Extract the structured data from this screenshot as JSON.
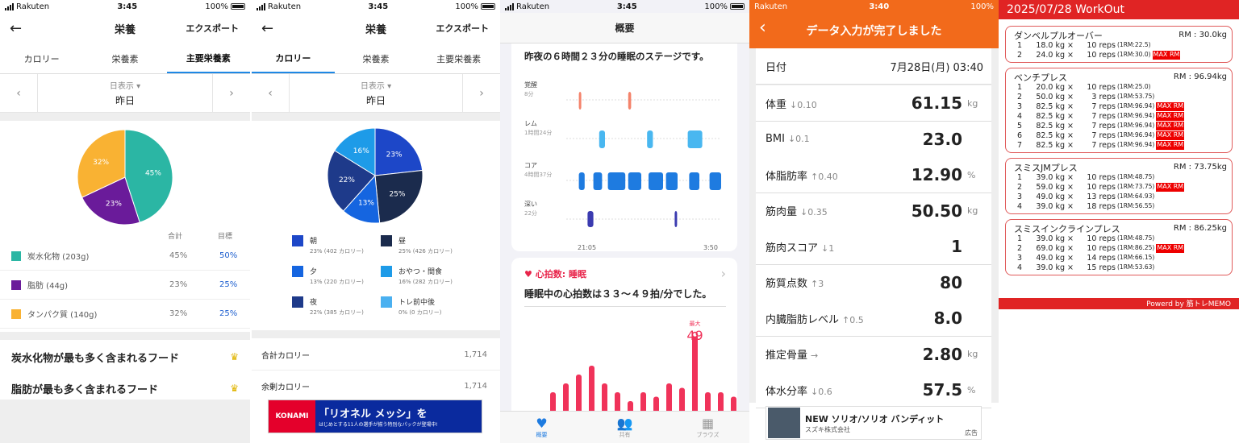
{
  "status": {
    "carrier": "Rakuten",
    "battery": "100%",
    "time1": "3:45",
    "time2": "3:45",
    "time3": "3:45",
    "time4": "3:40"
  },
  "p1": {
    "title": "栄養",
    "export": "エクスポート",
    "tabs": [
      "カロリー",
      "栄養素",
      "主要栄養素"
    ],
    "day_mode": "日表示",
    "day": "昨日",
    "pie": [
      {
        "pct": 45,
        "label": "45%",
        "color": "#2bb6a4"
      },
      {
        "pct": 23,
        "label": "23%",
        "color": "#6a1b9a"
      },
      {
        "pct": 32,
        "label": "32%",
        "color": "#f9b233"
      }
    ],
    "col_total": "合計",
    "col_goal": "目標",
    "rows": [
      {
        "name": "炭水化物 (203g)",
        "total": "45%",
        "goal": "50%",
        "color": "#2bb6a4"
      },
      {
        "name": "脂肪 (44g)",
        "total": "23%",
        "goal": "25%",
        "color": "#6a1b9a"
      },
      {
        "name": "タンパク質 (140g)",
        "total": "32%",
        "goal": "25%",
        "color": "#f9b233"
      }
    ],
    "food1": "炭水化物が最も多く含まれるフード",
    "food2": "脂肪が最も多く含まれるフード"
  },
  "p2": {
    "title": "栄養",
    "export": "エクスポート",
    "tabs": [
      "カロリー",
      "栄養素",
      "主要栄養素"
    ],
    "day_mode": "日表示",
    "day": "昨日",
    "pie": [
      {
        "pct": 23,
        "label": "23%",
        "color": "#1d47c8"
      },
      {
        "pct": 25,
        "label": "25%",
        "color": "#1b2b4d"
      },
      {
        "pct": 13,
        "label": "13%",
        "color": "#1565e0"
      },
      {
        "pct": 22,
        "label": "22%",
        "color": "#1e3a8a"
      },
      {
        "pct": 16,
        "label": "16%",
        "color": "#1e9be8"
      },
      {
        "pct": 0,
        "label": "",
        "color": "#4ab0f0"
      }
    ],
    "legend": [
      {
        "name": "朝",
        "sub": "23% (402 カロリー)",
        "color": "#1d47c8"
      },
      {
        "name": "昼",
        "sub": "25% (426 カロリー)",
        "color": "#1b2b4d"
      },
      {
        "name": "夕",
        "sub": "13% (220 カロリー)",
        "color": "#1565e0"
      },
      {
        "name": "おやつ・間食",
        "sub": "16% (282 カロリー)",
        "color": "#1e9be8"
      },
      {
        "name": "夜",
        "sub": "22% (385 カロリー)",
        "color": "#1e3a8a"
      },
      {
        "name": "トレ前中後",
        "sub": "0% (0 カロリー)",
        "color": "#4ab0f0"
      }
    ],
    "total_label": "合計カロリー",
    "total_val": "1,714",
    "remain_label": "余剰カロリー",
    "remain_val": "1,714",
    "ad_brand": "KONAMI",
    "ad_text": "「リオネル メッシ」を",
    "ad_sub": "はじめとする11人の選手が揃う特別なパックが登場中!"
  },
  "p3": {
    "title": "概要",
    "sleep_title": "昨夜の６時間２３分の睡眠のステージです。",
    "stages": [
      {
        "name": "覚醒",
        "dur": "8分",
        "color": "#f4836b"
      },
      {
        "name": "レム",
        "dur": "1時間24分",
        "color": "#49b7f0"
      },
      {
        "name": "コア",
        "dur": "4時間37分",
        "color": "#1e7be0"
      },
      {
        "name": "深い",
        "dur": "22分",
        "color": "#3b3bb0"
      }
    ],
    "t_start": "21:05",
    "t_end": "3:50",
    "hr_tag": "心拍数: 睡眠",
    "hr_text": "睡眠中の心拍数は３３〜４９拍/分でした。",
    "max_label": "最大",
    "max_val": "49",
    "hr_bars": [
      36,
      38,
      40,
      42,
      38,
      36,
      34,
      36,
      35,
      38,
      37,
      49,
      36,
      36,
      35
    ],
    "tabs": [
      "概要",
      "共有",
      "ブラウズ"
    ]
  },
  "p4": {
    "header": "データ入力が完了しました",
    "date_label": "日付",
    "date_val": "7月28日(月) 03:40",
    "rows": [
      {
        "label": "体重",
        "delta": "↓0.10",
        "val": "61.15",
        "unit": "kg"
      },
      {
        "label": "BMI",
        "delta": "↓0.1",
        "val": "23.0",
        "unit": ""
      },
      {
        "label": "体脂肪率",
        "delta": "↑0.40",
        "val": "12.90",
        "unit": "%"
      },
      {
        "label": "筋肉量",
        "delta": "↓0.35",
        "val": "50.50",
        "unit": "kg"
      },
      {
        "label": "筋肉スコア",
        "delta": "↓1",
        "val": "1",
        "unit": ""
      },
      {
        "label": "筋質点数",
        "delta": "↑3",
        "val": "80",
        "unit": ""
      },
      {
        "label": "内臓脂肪レベル",
        "delta": "↑0.5",
        "val": "8.0",
        "unit": ""
      },
      {
        "label": "推定骨量",
        "delta": "→",
        "val": "2.80",
        "unit": "kg"
      },
      {
        "label": "体水分率",
        "delta": "↓0.6",
        "val": "57.5",
        "unit": "%"
      }
    ],
    "ad_title": "NEW ソリオ/ソリオ バンディット",
    "ad_company": "スズキ株式会社",
    "ad_tag": "広告"
  },
  "p5": {
    "title": "2025/07/28 WorkOut",
    "footer": "Powerd by 筋トレMEMO",
    "maxrm": "MAX RM",
    "exercises": [
      {
        "name": "ダンベルプルオーバー",
        "rm": "RM : 30.0kg",
        "sets": [
          {
            "n": "1",
            "kg": "18.0 kg ×",
            "reps": "10 reps",
            "rm": "(1RM:22.5)",
            "max": false
          },
          {
            "n": "2",
            "kg": "24.0 kg ×",
            "reps": "10 reps",
            "rm": "(1RM:30.0)",
            "max": true
          }
        ]
      },
      {
        "name": "ベンチプレス",
        "rm": "RM : 96.94kg",
        "sets": [
          {
            "n": "1",
            "kg": "20.0 kg ×",
            "reps": "10 reps",
            "rm": "(1RM:25.0)",
            "max": false
          },
          {
            "n": "2",
            "kg": "50.0 kg ×",
            "reps": "3 reps",
            "rm": "(1RM:53.75)",
            "max": false
          },
          {
            "n": "3",
            "kg": "82.5 kg ×",
            "reps": "7 reps",
            "rm": "(1RM:96.94)",
            "max": true
          },
          {
            "n": "4",
            "kg": "82.5 kg ×",
            "reps": "7 reps",
            "rm": "(1RM:96.94)",
            "max": true
          },
          {
            "n": "5",
            "kg": "82.5 kg ×",
            "reps": "7 reps",
            "rm": "(1RM:96.94)",
            "max": true
          },
          {
            "n": "6",
            "kg": "82.5 kg ×",
            "reps": "7 reps",
            "rm": "(1RM:96.94)",
            "max": true
          },
          {
            "n": "7",
            "kg": "82.5 kg ×",
            "reps": "7 reps",
            "rm": "(1RM:96.94)",
            "max": true
          }
        ]
      },
      {
        "name": "スミスJMプレス",
        "rm": "RM : 73.75kg",
        "sets": [
          {
            "n": "1",
            "kg": "39.0 kg ×",
            "reps": "10 reps",
            "rm": "(1RM:48.75)",
            "max": false
          },
          {
            "n": "2",
            "kg": "59.0 kg ×",
            "reps": "10 reps",
            "rm": "(1RM:73.75)",
            "max": true
          },
          {
            "n": "3",
            "kg": "49.0 kg ×",
            "reps": "13 reps",
            "rm": "(1RM:64.93)",
            "max": false
          },
          {
            "n": "4",
            "kg": "39.0 kg ×",
            "reps": "18 reps",
            "rm": "(1RM:56.55)",
            "max": false
          }
        ]
      },
      {
        "name": "スミスインクラインプレス",
        "rm": "RM : 86.25kg",
        "sets": [
          {
            "n": "1",
            "kg": "39.0 kg ×",
            "reps": "10 reps",
            "rm": "(1RM:48.75)",
            "max": false
          },
          {
            "n": "2",
            "kg": "69.0 kg ×",
            "reps": "10 reps",
            "rm": "(1RM:86.25)",
            "max": true
          },
          {
            "n": "3",
            "kg": "49.0 kg ×",
            "reps": "14 reps",
            "rm": "(1RM:66.15)",
            "max": false
          },
          {
            "n": "4",
            "kg": "39.0 kg ×",
            "reps": "15 reps",
            "rm": "(1RM:53.63)",
            "max": false
          }
        ]
      }
    ]
  }
}
